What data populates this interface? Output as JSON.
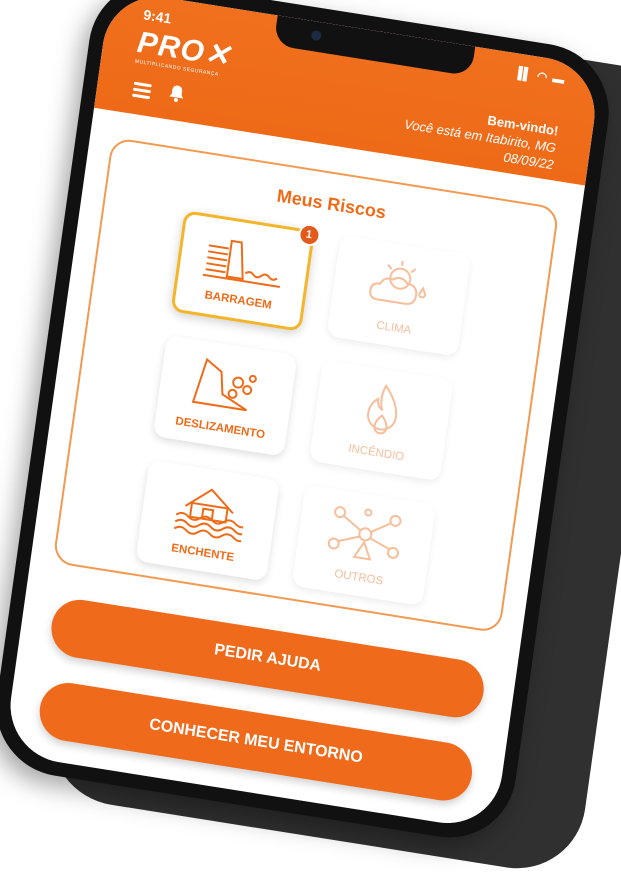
{
  "status": {
    "time": "9:41",
    "icons": "▐▌ ◠ ▬"
  },
  "header": {
    "logo": "PRO✕",
    "logo_sub": "MULTIPLICANDO SEGURANÇA",
    "greeting": "Bem-vindo!",
    "location": "Você está em Itabirito, MG",
    "date": "08/09/22"
  },
  "risks": {
    "title": "Meus Riscos",
    "badge_count": "1",
    "tiles": [
      {
        "label": "BARRAGEM",
        "icon": "dam-icon",
        "selected": true
      },
      {
        "label": "CLIMA",
        "icon": "weather-icon",
        "selected": false
      },
      {
        "label": "DESLIZAMENTO",
        "icon": "landslide-icon",
        "selected": false
      },
      {
        "label": "INCÊNDIO",
        "icon": "fire-icon",
        "selected": false
      },
      {
        "label": "ENCHENTE",
        "icon": "flood-icon",
        "selected": false
      },
      {
        "label": "OUTROS",
        "icon": "network-icon",
        "selected": false
      }
    ]
  },
  "actions": {
    "help_label": "PEDIR AJUDA",
    "surroundings_label": "CONHECER MEU ENTORNO"
  },
  "colors": {
    "accent": "#ef6a1b",
    "highlight": "#f5b52a"
  }
}
